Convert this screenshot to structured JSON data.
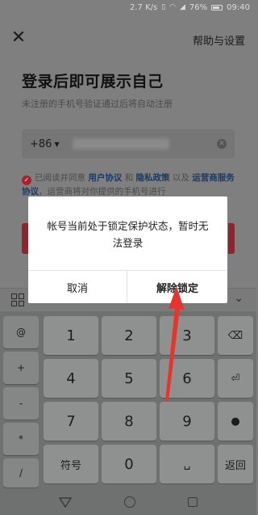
{
  "status_bar": {
    "speed": "2.7 K/s",
    "battery_percent": "76%",
    "time": "09:40"
  },
  "header": {
    "help_label": "帮助与设置"
  },
  "login": {
    "title": "登录后即可展示自己",
    "subtitle": "未注册的手机号验证通过后将自动注册",
    "country_code": "+86",
    "agreement_prefix": "已阅读并同意",
    "user_agreement": "用户协议",
    "and": "和",
    "privacy_policy": "隐私政策",
    "and2": "以及",
    "operator_agreement": "运营商服务协议",
    "agreement_suffix": "，运营商将对你提供的手机号进行"
  },
  "dialog": {
    "message": "帐号当前处于锁定保护状态，暂时无法登录",
    "cancel_label": "取消",
    "unlock_label": "解除锁定"
  },
  "keyboard": {
    "side_keys": [
      "@",
      "+",
      "-",
      "*",
      "/"
    ],
    "digits": [
      "1",
      "2",
      "3",
      "4",
      "5",
      "6",
      "7",
      "8",
      "9",
      "0"
    ],
    "symbols_label": "符号",
    "return_label": "返回"
  },
  "colors": {
    "accent_red": "#a8222d",
    "link_blue": "#1d3a66",
    "arrow_red": "#e8342f"
  }
}
